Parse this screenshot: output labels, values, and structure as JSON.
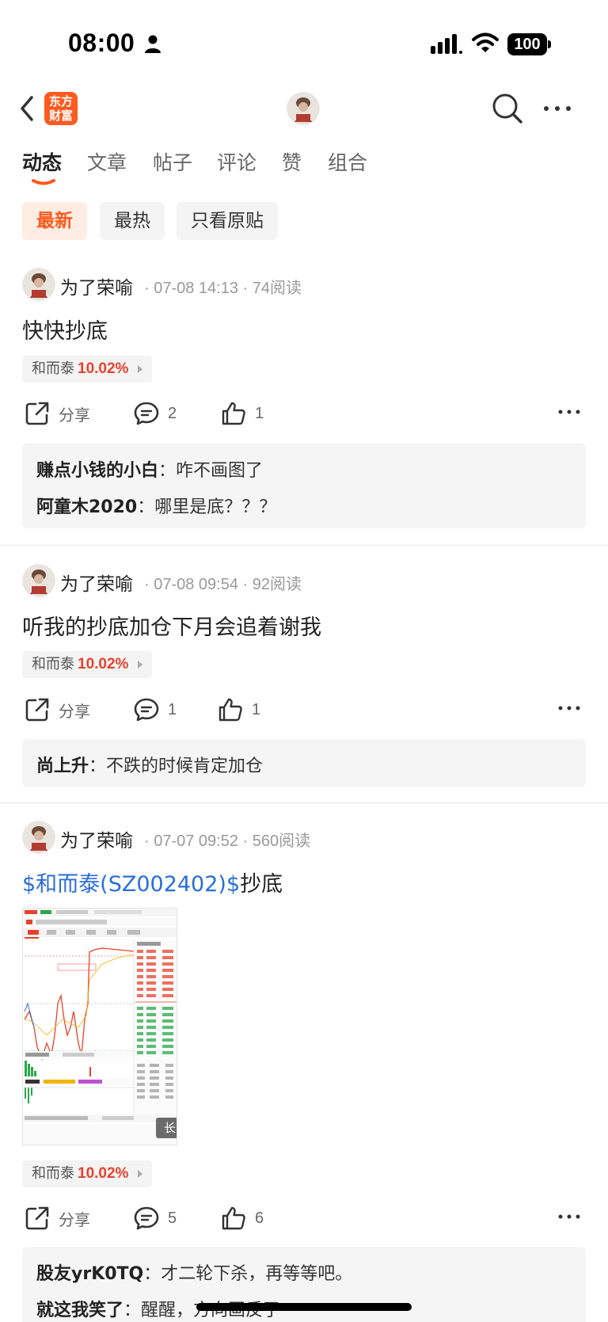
{
  "status_bar": {
    "time": "08:00",
    "battery": "100"
  },
  "nav": {
    "logo_text_line1": "东方",
    "logo_text_line2": "财富"
  },
  "tabs": [
    {
      "label": "动态",
      "active": true
    },
    {
      "label": "文章"
    },
    {
      "label": "帖子"
    },
    {
      "label": "评论"
    },
    {
      "label": "赞"
    },
    {
      "label": "组合"
    }
  ],
  "filters": [
    {
      "label": "最新",
      "active": true
    },
    {
      "label": "最热"
    },
    {
      "label": "只看原贴"
    }
  ],
  "posts": [
    {
      "author": "为了荣喻",
      "meta": "· 07-08 14:13 · 74阅读",
      "content": "快快抄底",
      "stock": {
        "name": "和而泰",
        "change": "10.02%"
      },
      "share_label": "分享",
      "comment_count": "2",
      "like_count": "1",
      "comments": [
        {
          "user": "赚点小钱的小白",
          "sep": "：",
          "text": "咋不画图了"
        },
        {
          "user": "阿童木2020",
          "sep": "：",
          "text": "哪里是底？？？"
        }
      ]
    },
    {
      "author": "为了荣喻",
      "meta": "· 07-08 09:54 · 92阅读",
      "content": "听我的抄底加仓下月会追着谢我",
      "stock": {
        "name": "和而泰",
        "change": "10.02%"
      },
      "share_label": "分享",
      "comment_count": "1",
      "like_count": "1",
      "comments": [
        {
          "user": "尚上升",
          "sep": "：",
          "text": "不跌的时候肯定加仓"
        }
      ]
    },
    {
      "author": "为了荣喻",
      "meta": "· 07-07 09:52 · 560阅读",
      "content_link": "$和而泰(SZ002402)$",
      "content_rest": "抄底",
      "image_badge": "长图",
      "stock": {
        "name": "和而泰",
        "change": "10.02%"
      },
      "share_label": "分享",
      "comment_count": "5",
      "like_count": "6",
      "comments": [
        {
          "user": "股友yrK0TQ",
          "sep": "：",
          "text": "才二轮下杀，再等等吧。"
        },
        {
          "user": "就这我笑了",
          "sep": "：",
          "text": "醒醒，方向画反了"
        }
      ]
    }
  ],
  "colors": {
    "accent": "#ff5a1f",
    "up": "#e8422c",
    "link": "#2a6ed8"
  },
  "icons": [
    "back-icon",
    "search-icon",
    "more-icon",
    "share-icon",
    "comment-icon",
    "like-icon",
    "person-icon",
    "signal-icon",
    "wifi-icon"
  ]
}
